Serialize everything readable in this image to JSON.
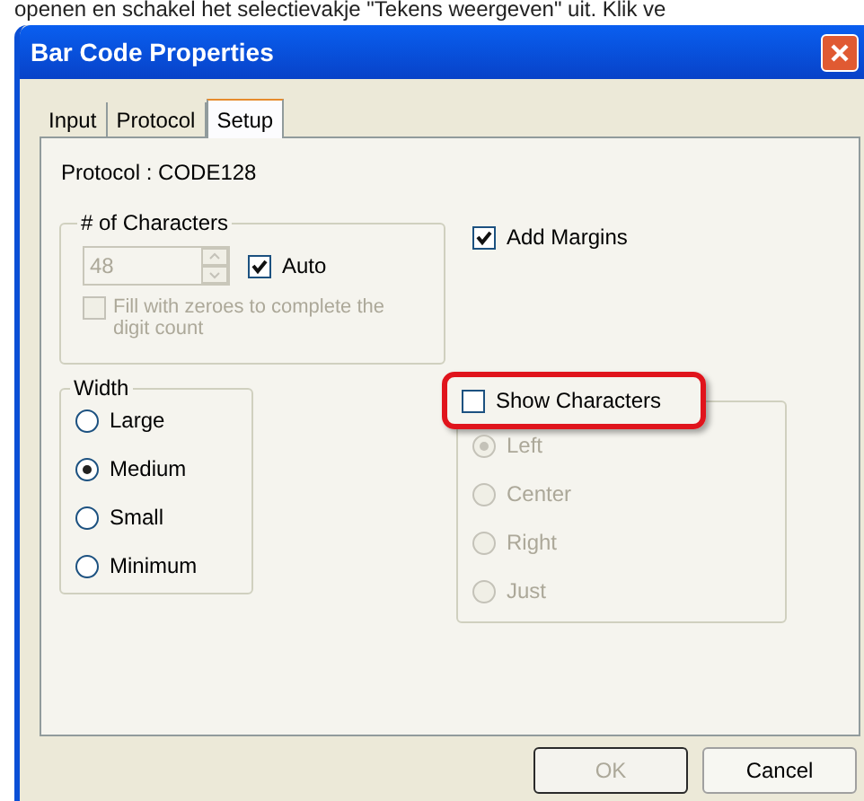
{
  "caption": "openen en schakel het selectievakje \"Tekens weergeven\" uit. Klik ve",
  "window": {
    "title": "Bar Code Properties"
  },
  "tabs": [
    {
      "label": "Input",
      "selected": false
    },
    {
      "label": "Protocol",
      "selected": false
    },
    {
      "label": "Setup",
      "selected": true
    }
  ],
  "protocol_label": "Protocol : CODE128",
  "characters_group": {
    "title": "# of Characters",
    "count": {
      "value": "48",
      "disabled": true
    },
    "auto": {
      "label": "Auto",
      "checked": true
    },
    "fill_zeroes": {
      "label": "Fill with zeroes to complete the digit count",
      "checked": false,
      "disabled": true
    }
  },
  "add_margins": {
    "label": "Add Margins",
    "checked": true
  },
  "width_group": {
    "title": "Width",
    "options": [
      {
        "label": "Large",
        "selected": false
      },
      {
        "label": "Medium",
        "selected": true
      },
      {
        "label": "Small",
        "selected": false
      },
      {
        "label": "Minimum",
        "selected": false
      }
    ]
  },
  "show_characters": {
    "label": "Show Characters",
    "checked": false,
    "highlighted": true,
    "options": [
      {
        "label": "Left",
        "selected": true,
        "disabled": true
      },
      {
        "label": "Center",
        "selected": false,
        "disabled": true
      },
      {
        "label": "Right",
        "selected": false,
        "disabled": true
      },
      {
        "label": "Just",
        "selected": false,
        "disabled": true
      }
    ]
  },
  "buttons": [
    {
      "label": "OK",
      "disabled": true
    },
    {
      "label": "Cancel",
      "disabled": false
    }
  ]
}
